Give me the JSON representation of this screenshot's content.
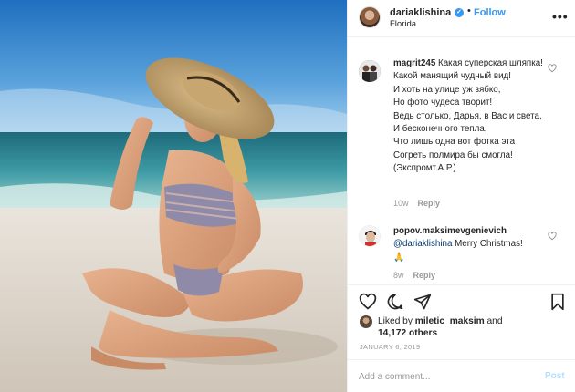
{
  "post": {
    "username": "dariaklishina",
    "follow_label": "Follow",
    "location": "Florida",
    "more_icon": "more-options-icon",
    "verified_icon": "verified-badge-icon"
  },
  "comments": [
    {
      "username": "magrit245",
      "text": "Какая суперская шляпка!\nКакой манящий чудный вид!\nИ хоть на улице уж зябко,\nНо фото чудеса творит!\nВедь столько, Дарья, в Вас и света,\nИ бесконечного тепла,\nЧто лишь одна вот фотка эта\nСогреть полмира бы смогла!\n(Экспромт.А.Р.)",
      "age": "10w",
      "reply_label": "Reply"
    },
    {
      "username": "popov.maksimevgenievich",
      "mention": "@dariaklishina",
      "text": " Merry Christmas!",
      "emoji": "🙏",
      "age": "8w",
      "reply_label": "Reply"
    }
  ],
  "likes": {
    "prefix": "Liked by ",
    "user": "miletic_maksim",
    "and": " and",
    "others": "14,172 others"
  },
  "date": "JANUARY 6, 2019",
  "add_comment": {
    "placeholder": "Add a comment...",
    "post_label": "Post"
  },
  "colors": {
    "accent": "#3897f0",
    "post_disabled": "#b2dffc",
    "meta": "#999999",
    "text": "#262626"
  }
}
